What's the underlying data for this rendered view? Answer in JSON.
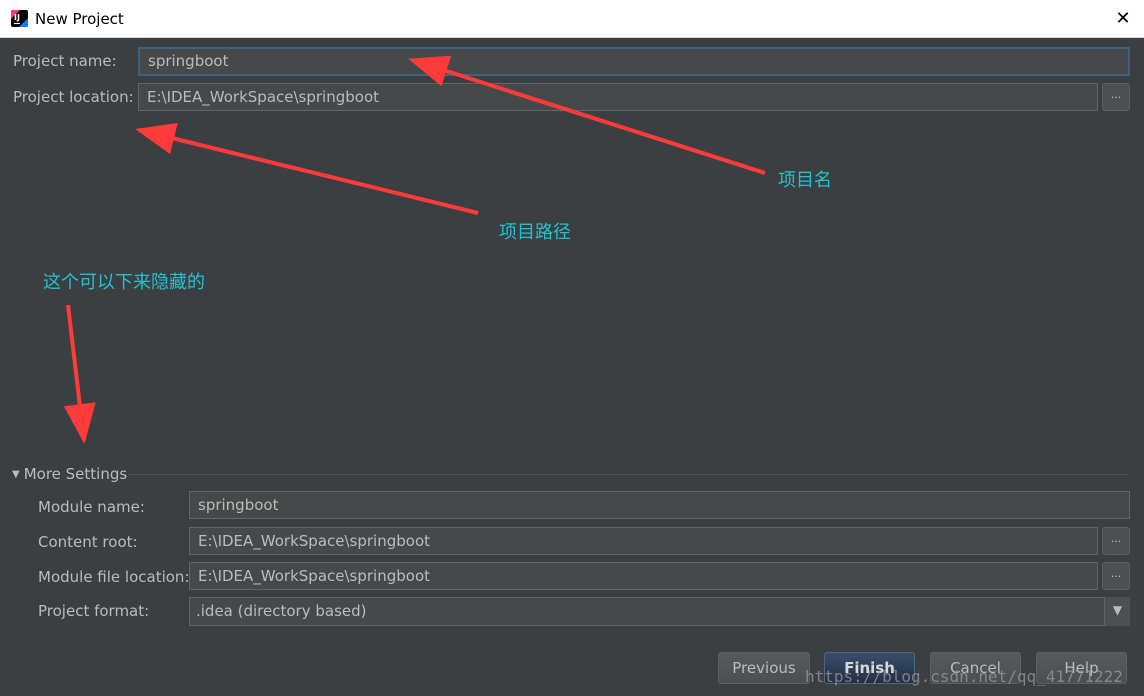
{
  "window": {
    "title": "New Project",
    "close_symbol": "✕"
  },
  "form": {
    "project_name_label": "Project name:",
    "project_name_value": "springboot",
    "project_location_label": "Project location:",
    "project_location_value": "E:\\IDEA_WorkSpace\\springboot",
    "browse_symbol": "..."
  },
  "annotations": {
    "project_name": "项目名",
    "project_path": "项目路径",
    "collapsible": "这个可以下来隐藏的",
    "color": "#1fc3cf",
    "arrow_color": "#ff3a3a"
  },
  "more_settings": {
    "title": "More Settings",
    "module_name_label": "Module name:",
    "module_name_value": "springboot",
    "content_root_label": "Content root:",
    "content_root_value": "E:\\IDEA_WorkSpace\\springboot",
    "module_file_location_label": "Module file location:",
    "module_file_location_value": "E:\\IDEA_WorkSpace\\springboot",
    "project_format_label": "Project format:",
    "project_format_value": ".idea (directory based)"
  },
  "buttons": {
    "previous": "Previous",
    "finish": "Finish",
    "cancel": "Cancel",
    "help": "Help"
  },
  "watermark": "https://blog.csdn.net/qq_41771222"
}
